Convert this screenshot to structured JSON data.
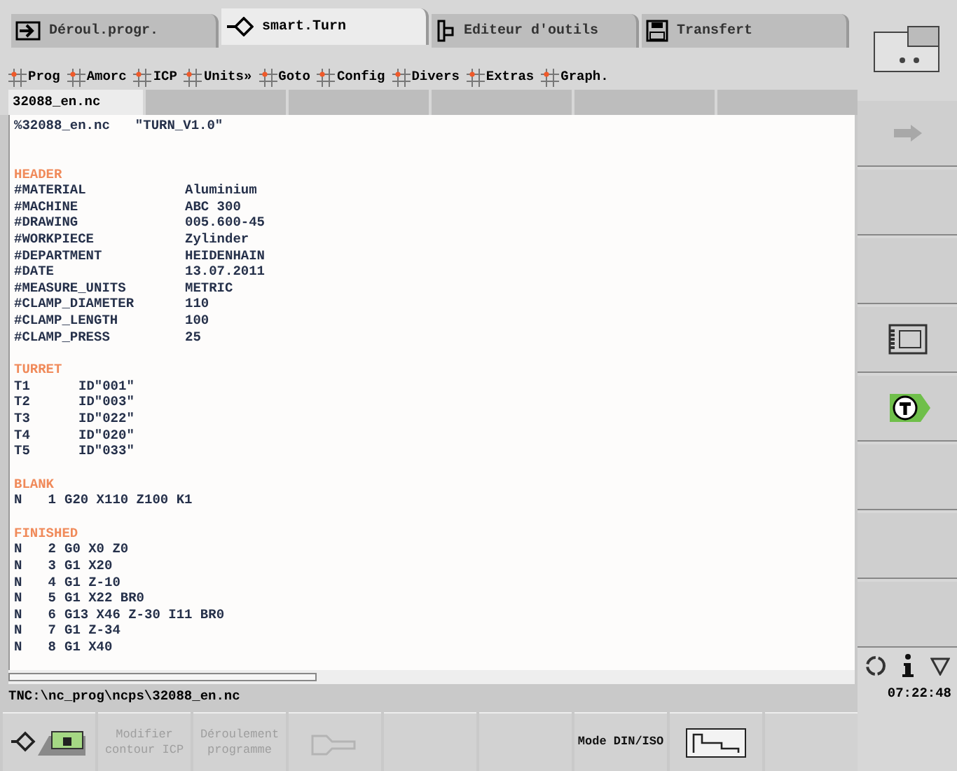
{
  "tabs": [
    {
      "label": "Déroul.progr.",
      "kind": "run",
      "selected": false
    },
    {
      "label": "smart.Turn",
      "kind": "diamond",
      "selected": true
    },
    {
      "label": "Editeur d'outils",
      "kind": "tool",
      "selected": false
    },
    {
      "label": "Transfert",
      "kind": "save",
      "selected": false
    }
  ],
  "menu": [
    "Prog",
    "Amorc",
    "ICP",
    "Units»",
    "Goto",
    "Config",
    "Divers",
    "Extras",
    "Graph."
  ],
  "file_tab": "32088_en.nc",
  "editor": {
    "lines": [
      {
        "kind": "title",
        "cells": [
          "%32088_en.nc",
          "\"TURN_V1.0\""
        ]
      },
      {
        "kind": "section",
        "cells": [
          "HEADER"
        ]
      },
      {
        "kind": "field",
        "cells": [
          "#MATERIAL",
          "Aluminium"
        ]
      },
      {
        "kind": "field",
        "cells": [
          "#MACHINE",
          "ABC 300"
        ]
      },
      {
        "kind": "field",
        "cells": [
          "#DRAWING",
          "005.600-45"
        ]
      },
      {
        "kind": "field",
        "cells": [
          "#WORKPIECE",
          "Zylinder"
        ]
      },
      {
        "kind": "field",
        "cells": [
          "#DEPARTMENT",
          "HEIDENHAIN"
        ]
      },
      {
        "kind": "field",
        "cells": [
          "#DATE",
          "13.07.2011"
        ]
      },
      {
        "kind": "field",
        "cells": [
          "#MEASURE_UNITS",
          "METRIC"
        ]
      },
      {
        "kind": "field",
        "cells": [
          "#CLAMP_DIAMETER",
          "110"
        ]
      },
      {
        "kind": "field",
        "cells": [
          "#CLAMP_LENGTH",
          "100"
        ]
      },
      {
        "kind": "field",
        "cells": [
          "#CLAMP_PRESS",
          "25"
        ]
      },
      {
        "kind": "section",
        "cells": [
          "TURRET"
        ]
      },
      {
        "kind": "tool",
        "cells": [
          "T1",
          "ID\"001\""
        ]
      },
      {
        "kind": "tool",
        "cells": [
          "T2",
          "ID\"003\""
        ]
      },
      {
        "kind": "tool",
        "cells": [
          "T3",
          "ID\"022\""
        ]
      },
      {
        "kind": "tool",
        "cells": [
          "T4",
          "ID\"020\""
        ]
      },
      {
        "kind": "tool",
        "cells": [
          "T5",
          "ID\"033\""
        ]
      },
      {
        "kind": "section",
        "cells": [
          "BLANK"
        ]
      },
      {
        "kind": "block",
        "cells": [
          "N",
          "1",
          "G20 X110 Z100 K1"
        ]
      },
      {
        "kind": "section",
        "cells": [
          "FINISHED"
        ]
      },
      {
        "kind": "block",
        "cells": [
          "N",
          "2",
          "G0 X0 Z0"
        ]
      },
      {
        "kind": "block",
        "cells": [
          "N",
          "3",
          "G1 X20"
        ]
      },
      {
        "kind": "block",
        "cells": [
          "N",
          "4",
          "G1 Z-10"
        ]
      },
      {
        "kind": "block",
        "cells": [
          "N",
          "5",
          "G1 X22 BR0"
        ]
      },
      {
        "kind": "block",
        "cells": [
          "N",
          "6",
          "G13 X46 Z-30 I11 BR0"
        ]
      },
      {
        "kind": "block",
        "cells": [
          "N",
          "7",
          "G1 Z-34"
        ]
      },
      {
        "kind": "block",
        "cells": [
          "N",
          "8",
          "G1 X40"
        ]
      }
    ]
  },
  "status_path": "TNC:\\nc_prog\\ncps\\32088_en.nc",
  "time": "07:22:48",
  "side_softkeys": [
    {
      "kind": "arrow",
      "disabled": true
    },
    {
      "kind": "empty"
    },
    {
      "kind": "empty"
    },
    {
      "kind": "film",
      "disabled": false
    },
    {
      "kind": "tool",
      "disabled": false
    },
    {
      "kind": "empty"
    },
    {
      "kind": "empty"
    },
    {
      "kind": "empty"
    }
  ],
  "softkeys": [
    {
      "kind": "machine",
      "disabled": false
    },
    {
      "kind": "text",
      "label": "Modifier contour ICP",
      "disabled": true
    },
    {
      "kind": "text",
      "label": "Déroulement programme",
      "disabled": true
    },
    {
      "kind": "wrench",
      "disabled": true
    },
    {
      "kind": "empty"
    },
    {
      "kind": "empty"
    },
    {
      "kind": "text",
      "label": "Mode DIN/ISO",
      "disabled": false
    },
    {
      "kind": "contour",
      "disabled": false
    },
    {
      "kind": "empty"
    }
  ]
}
